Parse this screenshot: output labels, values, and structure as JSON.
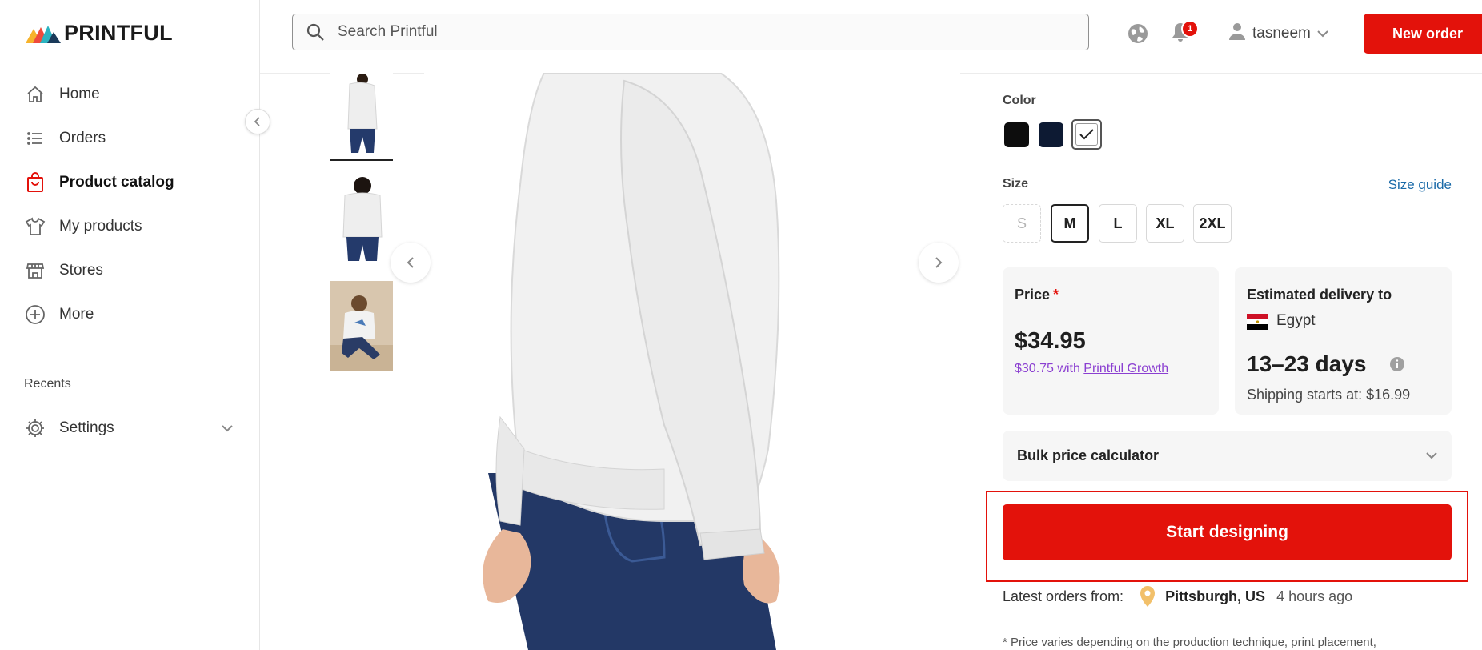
{
  "app": {
    "brand": "PRINTFUL"
  },
  "sidebar": {
    "items": [
      {
        "label": "Home",
        "icon": "home-icon"
      },
      {
        "label": "Orders",
        "icon": "list-icon"
      },
      {
        "label": "Product catalog",
        "icon": "shopping-bag-icon",
        "active": true
      },
      {
        "label": "My products",
        "icon": "tshirt-icon"
      },
      {
        "label": "Stores",
        "icon": "store-icon"
      },
      {
        "label": "More",
        "icon": "plus-circle-icon"
      }
    ],
    "recents_label": "Recents",
    "settings_label": "Settings"
  },
  "header": {
    "search_placeholder": "Search Printful",
    "notifications_count": "1",
    "username": "tasneem",
    "new_order_label": "New order"
  },
  "product": {
    "color_label": "Color",
    "colors": [
      {
        "name": "black",
        "hex": "#0d0d0d"
      },
      {
        "name": "navy",
        "hex": "#0d1a33"
      },
      {
        "name": "white",
        "hex": "#ffffff",
        "selected": true
      }
    ],
    "size_label": "Size",
    "size_guide_label": "Size guide",
    "sizes": [
      {
        "label": "S",
        "state": "unavailable"
      },
      {
        "label": "M",
        "state": "selected"
      },
      {
        "label": "L",
        "state": "available"
      },
      {
        "label": "XL",
        "state": "available"
      },
      {
        "label": "2XL",
        "state": "available"
      }
    ],
    "price": {
      "title": "Price",
      "required_mark": "*",
      "value": "$34.95",
      "growth_prefix": "$30.75 with",
      "growth_link": "Printful Growth"
    },
    "delivery": {
      "title": "Estimated delivery to",
      "country": "Egypt",
      "days": "13–23 days",
      "shipping": "Shipping starts at: $16.99"
    },
    "bulk_label": "Bulk price calculator",
    "start_label": "Start designing",
    "latest_orders": {
      "label": "Latest orders from:",
      "city": "Pittsburgh, US",
      "ago": "4 hours ago"
    },
    "footnote": "* Price varies depending on the production technique, print placement,"
  },
  "colors": {
    "accent": "#e3120b",
    "link": "#1a6aa8",
    "growth_purple": "#8b3fd1"
  }
}
